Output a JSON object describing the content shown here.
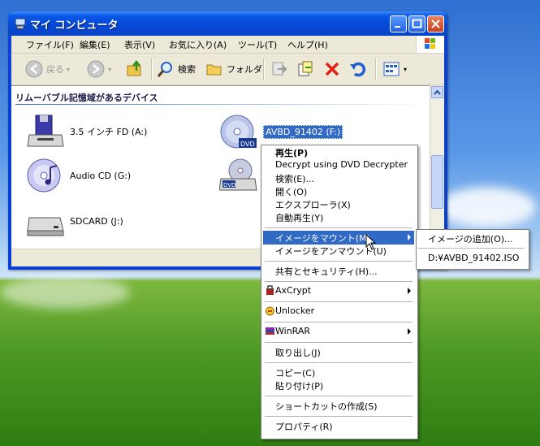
{
  "window": {
    "title": "マイ コンピュータ",
    "menu": [
      "ファイル(F)",
      "編集(E)",
      "表示(V)",
      "お気に入り(A)",
      "ツール(T)",
      "ヘルプ(H)"
    ],
    "toolbar": {
      "back": "戻る",
      "search": "検索",
      "folders": "フォルダ"
    }
  },
  "content": {
    "group_header": "リムーバブル記憶域があるデバイス",
    "devices": [
      {
        "label": "3.5 インチ FD (A:)",
        "icon": "floppy-drive-icon"
      },
      {
        "label": "AVBD_91402 (F:)",
        "icon": "dvd-disc-icon",
        "selected": true
      },
      {
        "label": "Audio CD (G:)",
        "icon": "audio-cd-icon"
      },
      {
        "label": "",
        "icon": "dvd-drive-icon"
      },
      {
        "label": "SDCARD (J:)",
        "icon": "removable-drive-icon"
      }
    ]
  },
  "context_menu": {
    "items": [
      {
        "label": "再生(P)",
        "bold": true
      },
      {
        "label": "Decrypt using DVD Decrypter"
      },
      {
        "label": "検索(E)..."
      },
      {
        "label": "開く(O)"
      },
      {
        "label": "エクスプローラ(X)"
      },
      {
        "label": "自動再生(Y)"
      },
      {
        "label": "イメージをマウント(M)",
        "submenu": true,
        "highlighted": true
      },
      {
        "label": "イメージをアンマウント(U)"
      },
      {
        "label": "共有とセキュリティ(H)..."
      },
      {
        "label": "AxCrypt",
        "submenu": true,
        "icon": "axcrypt-icon"
      },
      {
        "label": "Unlocker",
        "icon": "unlocker-icon"
      },
      {
        "label": "WinRAR",
        "submenu": true,
        "icon": "winrar-icon"
      },
      {
        "label": "取り出し(J)"
      },
      {
        "label": "コピー(C)"
      },
      {
        "label": "貼り付け(P)"
      },
      {
        "label": "ショートカットの作成(S)"
      },
      {
        "label": "プロパティ(R)"
      }
    ]
  },
  "submenu": {
    "items": [
      {
        "label": "イメージの追加(O)..."
      },
      {
        "label": "D:¥AVBD_91402.ISO"
      }
    ]
  },
  "colors": {
    "highlight": "#316ac5",
    "titlebar": "#0a58e8",
    "window_bg": "#ece9d8"
  }
}
